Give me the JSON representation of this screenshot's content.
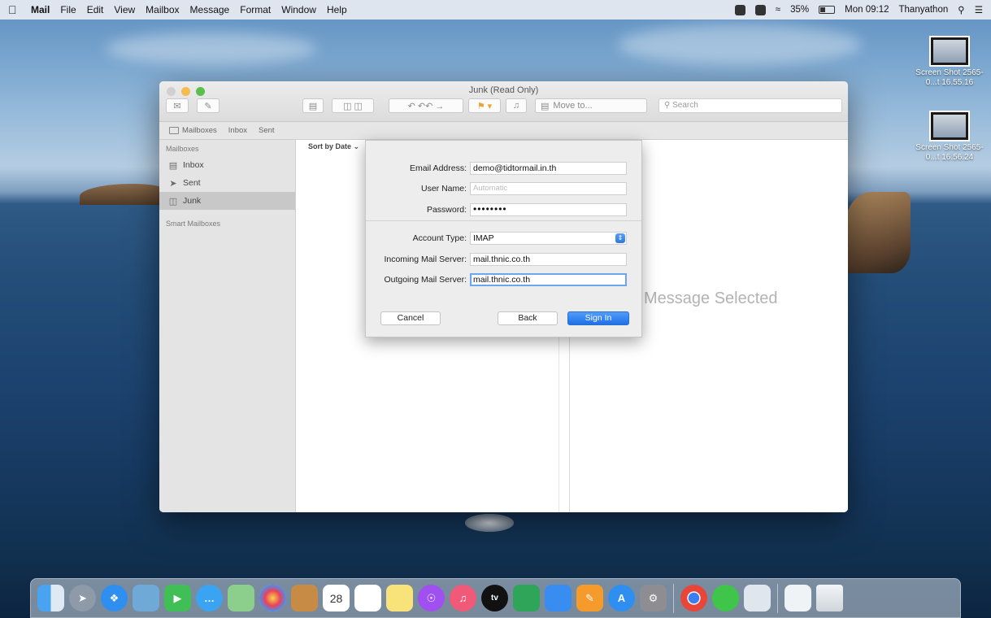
{
  "menubar": {
    "app_name": "Mail",
    "items": [
      "File",
      "Edit",
      "View",
      "Mailbox",
      "Message",
      "Format",
      "Window",
      "Help"
    ],
    "battery": "35%",
    "clock": "Mon 09:12",
    "user": "Thanyathon"
  },
  "desktop": {
    "icons": [
      {
        "label": "Screen Shot 2565-0...t 16.55.16"
      },
      {
        "label": "Screen Shot 2565-0...t 16.56.24"
      }
    ]
  },
  "window": {
    "title": "Junk (Read Only)",
    "toolbar": {
      "move_to": "Move to...",
      "search_placeholder": "Search"
    },
    "favorites": {
      "mailboxes": "Mailboxes",
      "inbox": "Inbox",
      "sent": "Sent"
    },
    "sidebar": {
      "header": "Mailboxes",
      "items": [
        {
          "label": "Inbox",
          "icon": "tray-icon"
        },
        {
          "label": "Sent",
          "icon": "paper-plane-icon"
        },
        {
          "label": "Junk",
          "icon": "junk-bin-icon",
          "selected": true
        }
      ],
      "smart_header": "Smart Mailboxes"
    },
    "message_list": {
      "sort_label": "Sort by Date"
    },
    "reading_pane": {
      "placeholder": "Message Selected"
    }
  },
  "account_sheet": {
    "fields": {
      "email_label": "Email Address:",
      "email_value": "demo@tidtormail.in.th",
      "username_label": "User Name:",
      "username_placeholder": "Automatic",
      "password_label": "Password:",
      "password_value": "••••••••",
      "account_type_label": "Account Type:",
      "account_type_value": "IMAP",
      "incoming_label": "Incoming Mail Server:",
      "incoming_value": "mail.thnic.co.th",
      "outgoing_label": "Outgoing Mail Server:",
      "outgoing_value": "mail.thnic.co.th"
    },
    "buttons": {
      "cancel": "Cancel",
      "back": "Back",
      "sign_in": "Sign In"
    }
  },
  "dock": {
    "calendar_day": "28",
    "tv_label": "tv",
    "apps": [
      "finder-icon",
      "launchpad-icon",
      "safari-icon",
      "preview-icon",
      "facetime-icon",
      "messages-icon",
      "maps-icon",
      "photos-icon",
      "contacts-icon",
      "calendar-icon",
      "reminders-icon",
      "notes-icon",
      "podcasts-icon",
      "music-icon",
      "tv-icon",
      "numbers-icon",
      "keynote-icon",
      "pages-icon",
      "app-store-icon",
      "system-preferences-icon",
      "chrome-icon",
      "line-icon",
      "downloads-stack-icon",
      "documents-stack-icon",
      "trash-icon"
    ]
  }
}
